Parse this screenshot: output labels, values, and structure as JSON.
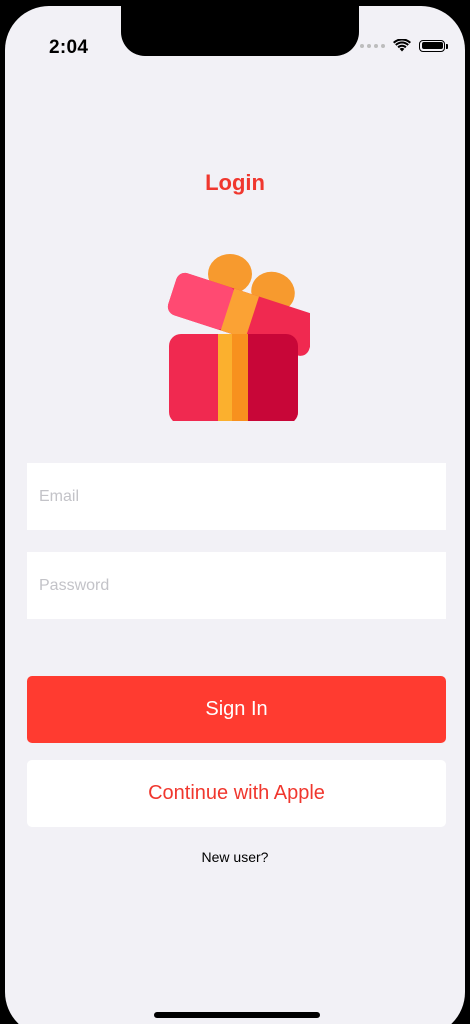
{
  "status_bar": {
    "time": "2:04"
  },
  "header": {
    "title": "Login"
  },
  "illustration": {
    "icon": "gift-icon"
  },
  "form": {
    "email_placeholder": "Email",
    "email_value": "",
    "password_placeholder": "Password",
    "password_value": ""
  },
  "actions": {
    "sign_in_label": "Sign In",
    "apple_label": "Continue with Apple",
    "new_user_label": "New user?"
  },
  "colors": {
    "accent": "#ff3b30",
    "title": "#f0372e",
    "background": "#f2f1f6"
  }
}
